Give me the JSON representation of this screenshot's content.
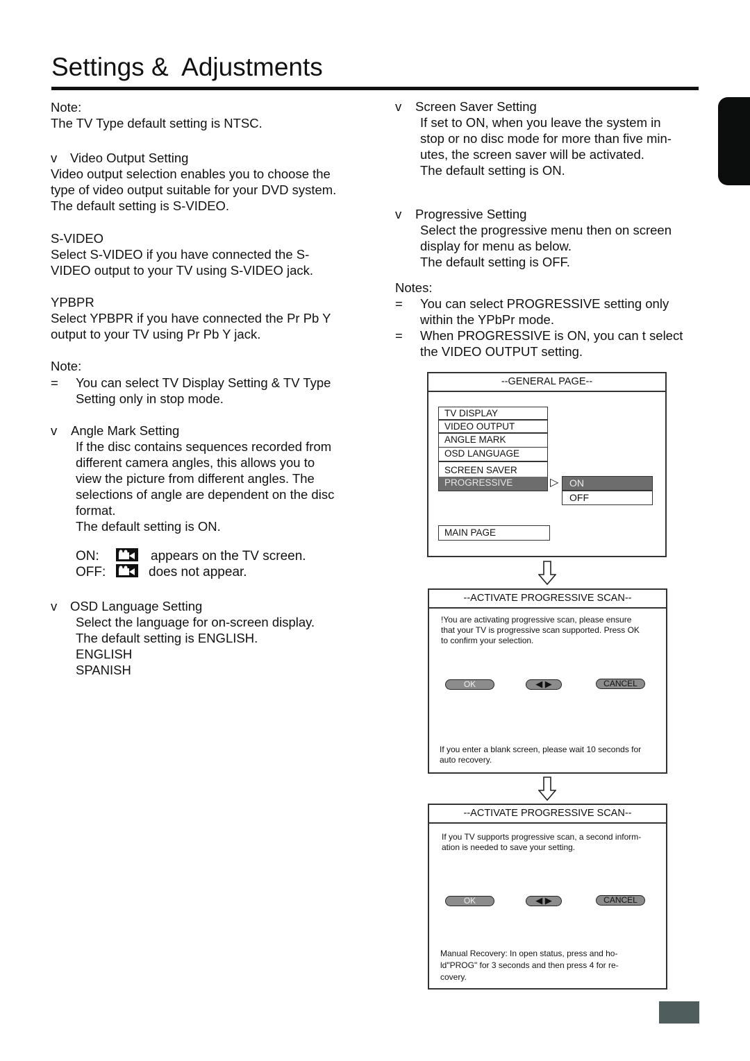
{
  "header": {
    "title": "Settings &  Adjustments"
  },
  "left": {
    "note1_label": "Note:",
    "note1_text": "The TV Type default setting is NTSC.",
    "video_output": {
      "bullet": "v",
      "heading": "Video Output Setting",
      "lines": [
        "Video output selection enables you to choose the",
        "type of video output suitable for your DVD system.",
        "The default setting is S-VIDEO."
      ]
    },
    "svideo": {
      "heading": "S-VIDEO",
      "lines": [
        "Select S-VIDEO if you have connected the S-",
        "VIDEO output to your TV using S-VIDEO jack."
      ]
    },
    "ypbpr": {
      "heading": "YPBPR",
      "lines": [
        "Select YPBPR if you have connected the Pr Pb Y",
        "output to your TV using Pr Pb Y jack."
      ]
    },
    "note2_label": "Note:",
    "note2": {
      "bullet": "=",
      "lines": [
        "You can select TV Display Setting & TV Type",
        "Setting only in stop mode."
      ]
    },
    "angle_mark": {
      "bullet": "v",
      "heading": "Angle Mark Setting",
      "lines": [
        "If the disc contains sequences recorded from",
        "different camera angles, this allows you to",
        "view the picture from different angles. The",
        "selections of angle are dependent on the disc",
        "format.",
        "The default setting is ON."
      ],
      "on_label": "ON:",
      "on_text": "appears on the TV screen.",
      "off_label": "OFF:",
      "off_text": "does not appear.",
      "icon": "camera-icon"
    },
    "osd_language": {
      "bullet": "v",
      "heading": "OSD Language Setting",
      "lines": [
        "Select the language for on-screen display.",
        "The default setting is ENGLISH.",
        "ENGLISH",
        "SPANISH"
      ]
    }
  },
  "right": {
    "screen_saver": {
      "bullet": "v",
      "heading": "Screen Saver Setting",
      "lines": [
        "If set to ON, when you leave the system in",
        "stop or no disc mode for more than five min-",
        "utes, the screen saver will be activated.",
        "The default setting is ON."
      ]
    },
    "progressive": {
      "bullet": "v",
      "heading": "Progressive Setting",
      "lines": [
        "Select the progressive menu then on screen",
        "display for menu as below.",
        "The default setting is OFF."
      ]
    },
    "notes_label": "Notes:",
    "notes": [
      {
        "bullet": "=",
        "lines": [
          "You can select PROGRESSIVE setting only",
          "within the YPbPr mode."
        ]
      },
      {
        "bullet": "=",
        "lines": [
          "When PROGRESSIVE is ON, you can t select",
          "the VIDEO OUTPUT setting."
        ]
      }
    ]
  },
  "osd_general": {
    "header": "--GENERAL PAGE--",
    "menu": [
      "TV DISPLAY",
      "VIDEO OUTPUT",
      "ANGLE MARK",
      "OSD LANGUAGE",
      "SCREEN SAVER",
      "PROGRESSIVE"
    ],
    "selected_menu": "PROGRESSIVE",
    "pointer": "▷",
    "options": [
      "ON",
      "OFF"
    ],
    "selected_option": "ON",
    "main_page": "MAIN PAGE"
  },
  "osd_activate_1": {
    "header": "--ACTIVATE PROGRESSIVE SCAN--",
    "message": [
      "!You are activating progressive scan, please ensure",
      "that your TV is progressive scan supported. Press OK",
      "to confirm your selection."
    ],
    "ok": "OK",
    "nav": "◀ ▶",
    "cancel": "CANCEL",
    "footer": [
      "If you enter a blank screen, please wait 10 seconds for",
      "auto recovery."
    ]
  },
  "osd_activate_2": {
    "header": "--ACTIVATE PROGRESSIVE SCAN--",
    "message": [
      "If you TV supports progressive scan, a second inform-",
      "ation is needed to save your setting."
    ],
    "ok": "OK",
    "nav": "◀ ▶",
    "cancel": "CANCEL",
    "footer": [
      "Manual Recovery: In open status, press and ho-",
      "ld\"PROG\" for 3 seconds and then press 4 for re-",
      "covery."
    ]
  },
  "colors": {
    "text": "#111111",
    "side_tab": "#0c0e0d",
    "page_box": "#4f5d5d",
    "osd_selected": "#6d6d6d",
    "pill": "#8c8c8c"
  }
}
